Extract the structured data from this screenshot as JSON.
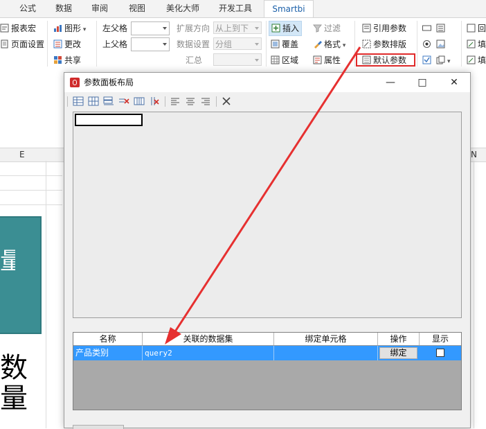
{
  "ribbon": {
    "tabs": [
      {
        "label": "公式"
      },
      {
        "label": "数据"
      },
      {
        "label": "审阅"
      },
      {
        "label": "视图"
      },
      {
        "label": "美化大师"
      },
      {
        "label": "开发工具"
      },
      {
        "label": "Smartbi"
      }
    ],
    "active_tab": "Smartbi",
    "group1": {
      "report_macro": "报表宏",
      "page_setup": "页面设置"
    },
    "group2": {
      "chart": "图形",
      "update": "更改",
      "share": "共享"
    },
    "group3": {
      "left_parent": "左父格",
      "top_parent": "上父格",
      "expand_dir": "扩展方向",
      "expand_value": "从上到下",
      "data_setting": "数据设置",
      "data_setting_value": "分组",
      "summary": "汇总"
    },
    "group4": {
      "insert": "插入",
      "overwrite": "覆盖",
      "area": "区域",
      "filter": "过滤",
      "format": "格式",
      "properties": "属性"
    },
    "group5": {
      "ref_param": "引用参数",
      "param_layout": "参数排版",
      "default_param": "默认参数"
    },
    "group6": {
      "fill1": "回",
      "fill2": "填",
      "fill3": "填"
    }
  },
  "sheet": {
    "col_e": "E",
    "col_n": "N",
    "teal_text": "量",
    "big_text": "数量"
  },
  "dialog": {
    "title": "参数面板布局",
    "min_btn": "—",
    "max_btn": "□",
    "close_btn": "✕",
    "grid": {
      "headers": [
        "名称",
        "关联的数据集",
        "绑定单元格",
        "操作",
        "显示"
      ],
      "rows": [
        {
          "name": "产品类别",
          "dataset": "query2",
          "cell": "",
          "action": "绑定",
          "show": false
        }
      ]
    }
  },
  "colors": {
    "accent_red": "#e02a2a",
    "teal": "#3b8e93",
    "row_selected": "#3399ff"
  }
}
